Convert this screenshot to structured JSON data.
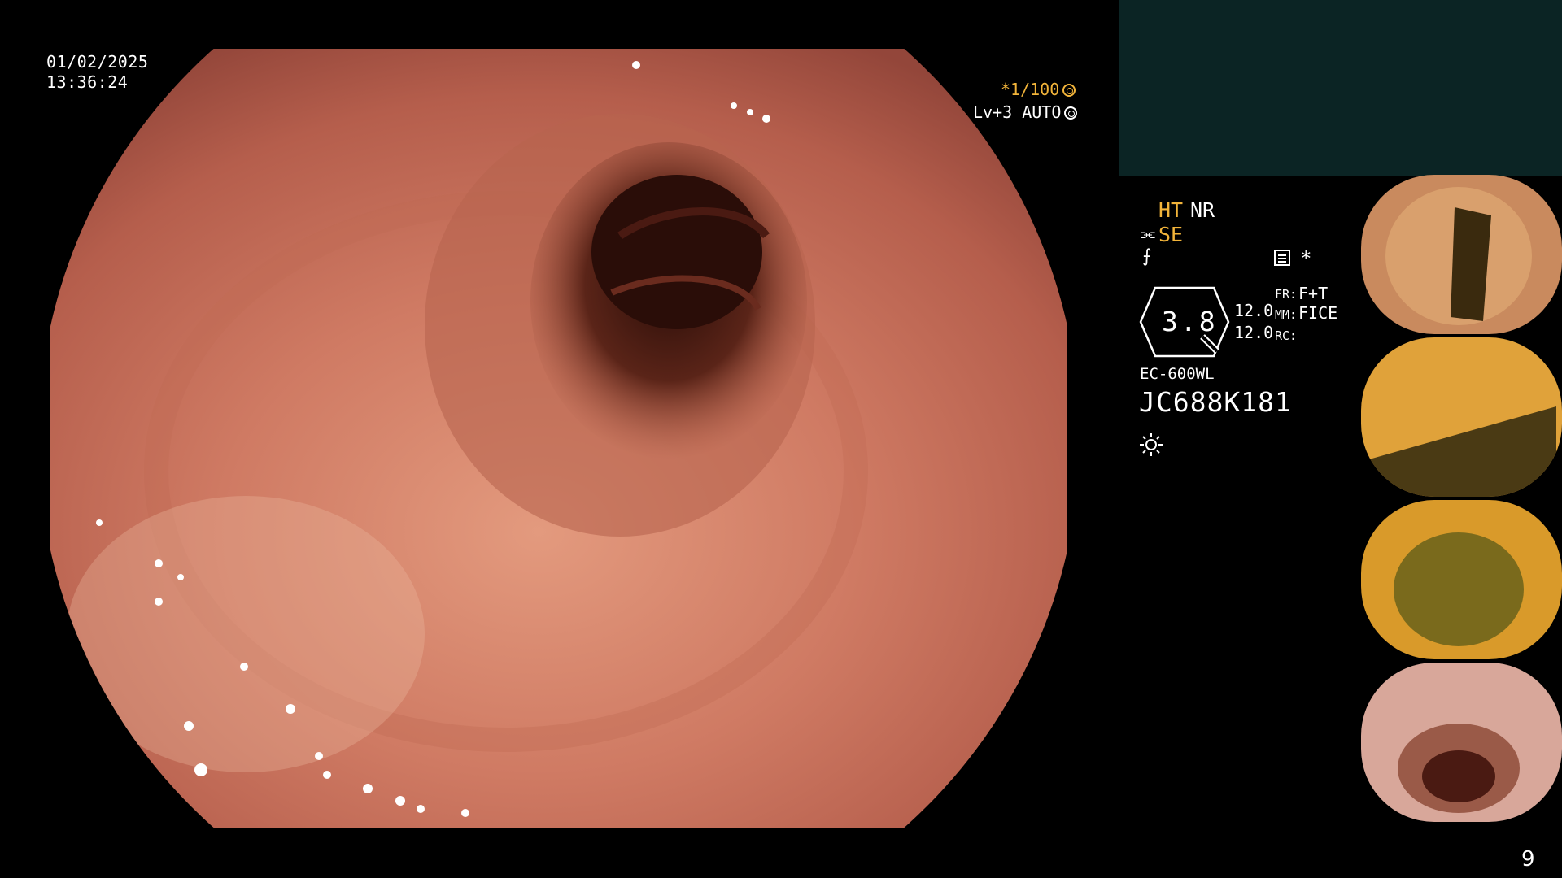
{
  "overlay": {
    "date": "01/02/2025",
    "time": "13:36:24",
    "shutter": "*1/100",
    "shutter_icon": "aperture-icon",
    "level": "Lv+3 AUTO",
    "level_icon": "auto-iris-icon"
  },
  "info_panel": {
    "ht": "HT",
    "nr": "NR",
    "se": "SE",
    "se_icon": "structure-enhance-icon",
    "lightning_icon": "lightning-icon",
    "menu_icon": "menu-icon",
    "asterisk": "*",
    "gauge_value": "3.8",
    "values": [
      "12.0",
      "12.0"
    ],
    "fr_key": "FR:",
    "fr_value": "F+T",
    "mm_key": "MM:",
    "mm_value": "FICE",
    "rc_key": "RC:",
    "model": "EC-600WL",
    "serial": "JC688K181",
    "brightness_icon": "sun-icon"
  },
  "colors": {
    "accent_orange": "#f2b43a",
    "teal_panel": "#0b2424",
    "tissue": "#c8705c"
  },
  "thumbnails": [
    {
      "label": "thumbnail-1",
      "tone": "#c98a5e"
    },
    {
      "label": "thumbnail-2",
      "tone": "#e0a23a"
    },
    {
      "label": "thumbnail-3",
      "tone": "#d99a2a"
    },
    {
      "label": "thumbnail-4",
      "tone": "#d8a79a"
    }
  ],
  "page_number": "9"
}
